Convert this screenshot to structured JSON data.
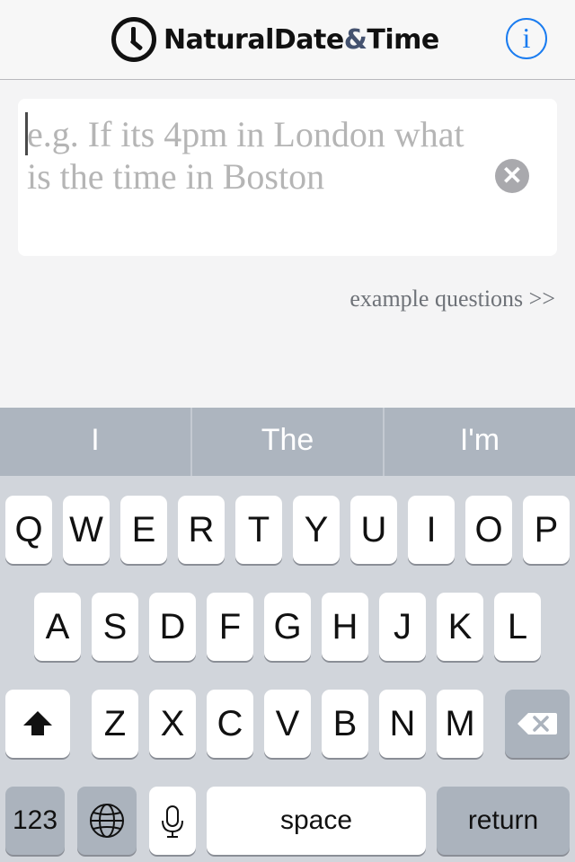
{
  "header": {
    "logo_text_a": "NaturalDate",
    "logo_text_amp": "&",
    "logo_text_b": "Time",
    "info_label": "i"
  },
  "query": {
    "placeholder": "e.g. If its 4pm in London what is the time in Boston",
    "clear_label": "✕"
  },
  "examples_link": "example questions >>",
  "keyboard": {
    "suggestions": [
      "I",
      "The",
      "I'm"
    ],
    "row1": [
      "Q",
      "W",
      "E",
      "R",
      "T",
      "Y",
      "U",
      "I",
      "O",
      "P"
    ],
    "row2": [
      "A",
      "S",
      "D",
      "F",
      "G",
      "H",
      "J",
      "K",
      "L"
    ],
    "row3": [
      "Z",
      "X",
      "C",
      "V",
      "B",
      "N",
      "M"
    ],
    "numbers_label": "123",
    "space_label": "space",
    "return_label": "return"
  },
  "colors": {
    "accent": "#1a7cf0",
    "keyboard_bg": "#d1d5db",
    "suggest_bar": "#adb5bf"
  }
}
